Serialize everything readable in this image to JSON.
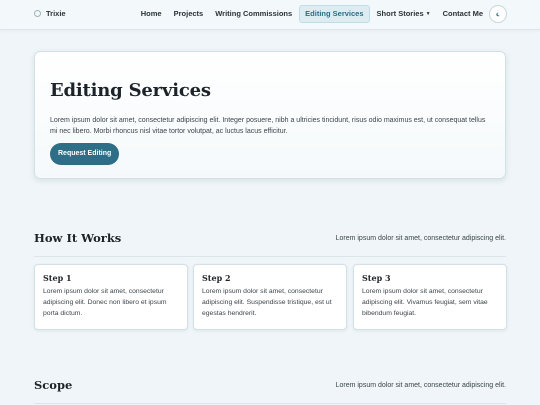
{
  "brand": {
    "name": "Trixie"
  },
  "nav": {
    "items": [
      {
        "label": "Home"
      },
      {
        "label": "Projects"
      },
      {
        "label": "Writing Commissions"
      },
      {
        "label": "Editing Services",
        "active": true
      },
      {
        "label": "Short Stories",
        "has_dropdown": true
      },
      {
        "label": "Contact Me"
      }
    ],
    "theme_toggle_icon": "moon-icon"
  },
  "hero": {
    "title": "Editing Services",
    "text": "Lorem ipsum dolor sit amet, consectetur adipiscing elit. Integer posuere, nibh a ultricies tincidunt, risus odio maximus est, ut consequat tellus mi nec libero. Morbi rhoncus nisl vitae tortor volutpat, ac luctus lacus efficitur.",
    "button_label": "Request Editing"
  },
  "how_it_works": {
    "title": "How It Works",
    "subtitle": "Lorem ipsum dolor sit amet, consectetur adipiscing elit.",
    "steps": [
      {
        "title": "Step 1",
        "text": "Lorem ipsum dolor sit amet, consectetur adipiscing elit. Donec non libero et ipsum porta dictum."
      },
      {
        "title": "Step 2",
        "text": "Lorem ipsum dolor sit amet, consectetur adipiscing elit. Suspendisse tristique, est ut egestas hendrerit."
      },
      {
        "title": "Step 3",
        "text": "Lorem ipsum dolor sit amet, consectetur adipiscing elit. Vivamus feugiat, sem vitae bibendum feugiat."
      }
    ]
  },
  "scope": {
    "title": "Scope",
    "subtitle": "Lorem ipsum dolor sit amet, consectetur adipiscing elit."
  },
  "colors": {
    "background": "#eff5f8",
    "accent": "#2e6e86",
    "active_nav_bg": "#dcecf1"
  }
}
